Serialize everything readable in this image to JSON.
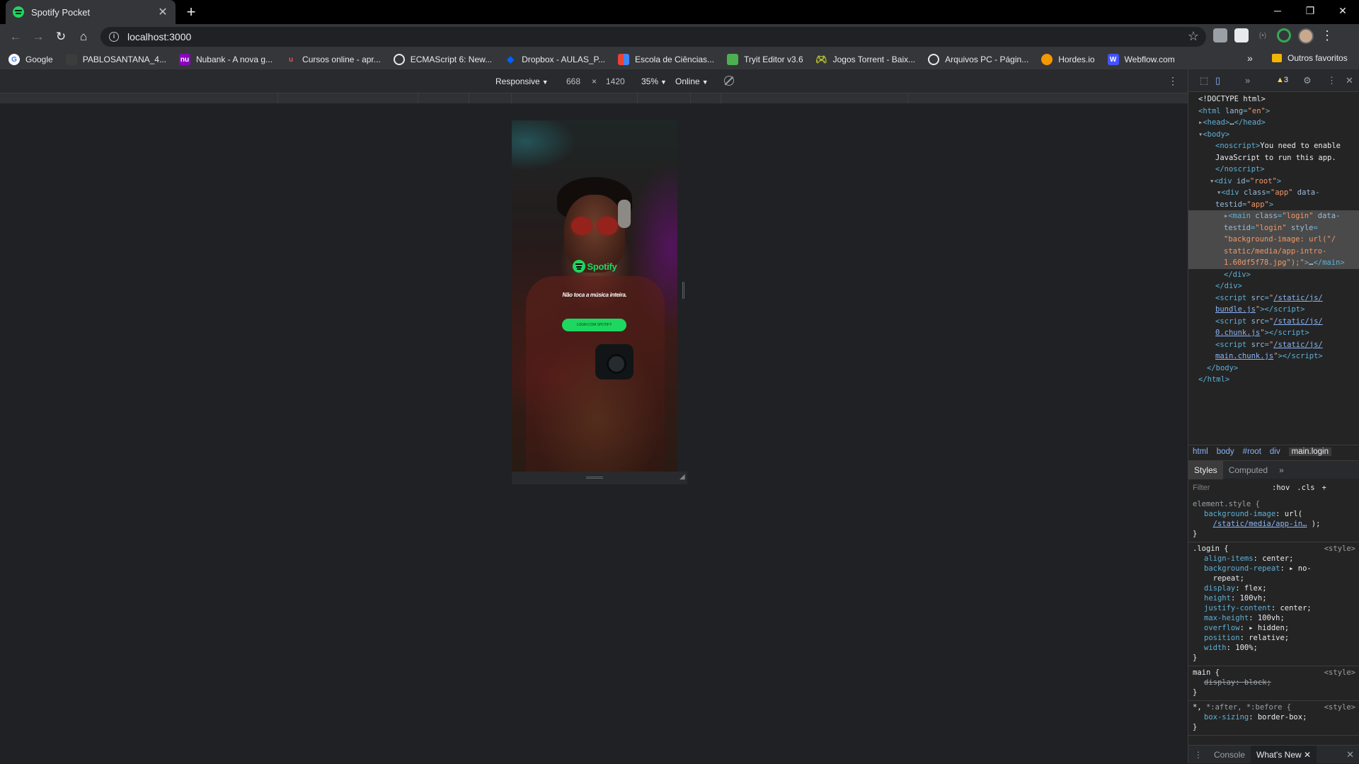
{
  "browser": {
    "tab_title": "Spotify Pocket",
    "url": "localhost:3000"
  },
  "bookmarks": [
    {
      "label": "Google",
      "color": "#ffffff"
    },
    {
      "label": "PABLOSANTANA_4...",
      "color": "#3c3c3c"
    },
    {
      "label": "Nubank - A nova g...",
      "color": "#8a05be"
    },
    {
      "label": "Cursos online - apr...",
      "color": "#ec5252"
    },
    {
      "label": "ECMAScript 6: New...",
      "color": "#e8eaed"
    },
    {
      "label": "Dropbox - AULAS_P...",
      "color": "#0061ff"
    },
    {
      "label": "Escola de Ciências...",
      "color": "#f4b400"
    },
    {
      "label": "Tryit Editor v3.6",
      "color": "#4caf50"
    },
    {
      "label": "Jogos Torrent - Baix...",
      "color": "#c0ca33"
    },
    {
      "label": "Arquivos PC - Págin...",
      "color": "#e8eaed"
    },
    {
      "label": "Hordes.io",
      "color": "#f29900"
    },
    {
      "label": "Webflow.com",
      "color": "#4353ff"
    }
  ],
  "bookmarks_other": "Outros favoritos",
  "device_toolbar": {
    "mode": "Responsive",
    "width": "668",
    "times": "×",
    "height": "1420",
    "zoom": "35%",
    "network": "Online"
  },
  "app": {
    "logo_text": "Spotify",
    "tagline": "Não toca a música inteira.",
    "login_button": "LOGIN COM SPOTIFY",
    "accent": "#1ed760"
  },
  "devtools": {
    "warnings": "3",
    "breadcrumbs": [
      "html",
      "body",
      "#root",
      "div",
      "main.login"
    ],
    "tabs": [
      "Styles",
      "Computed"
    ],
    "filter_placeholder": "Filter",
    "hov": ":hov",
    "cls": ".cls",
    "drawer_tabs": [
      "Console",
      "What's New"
    ]
  }
}
